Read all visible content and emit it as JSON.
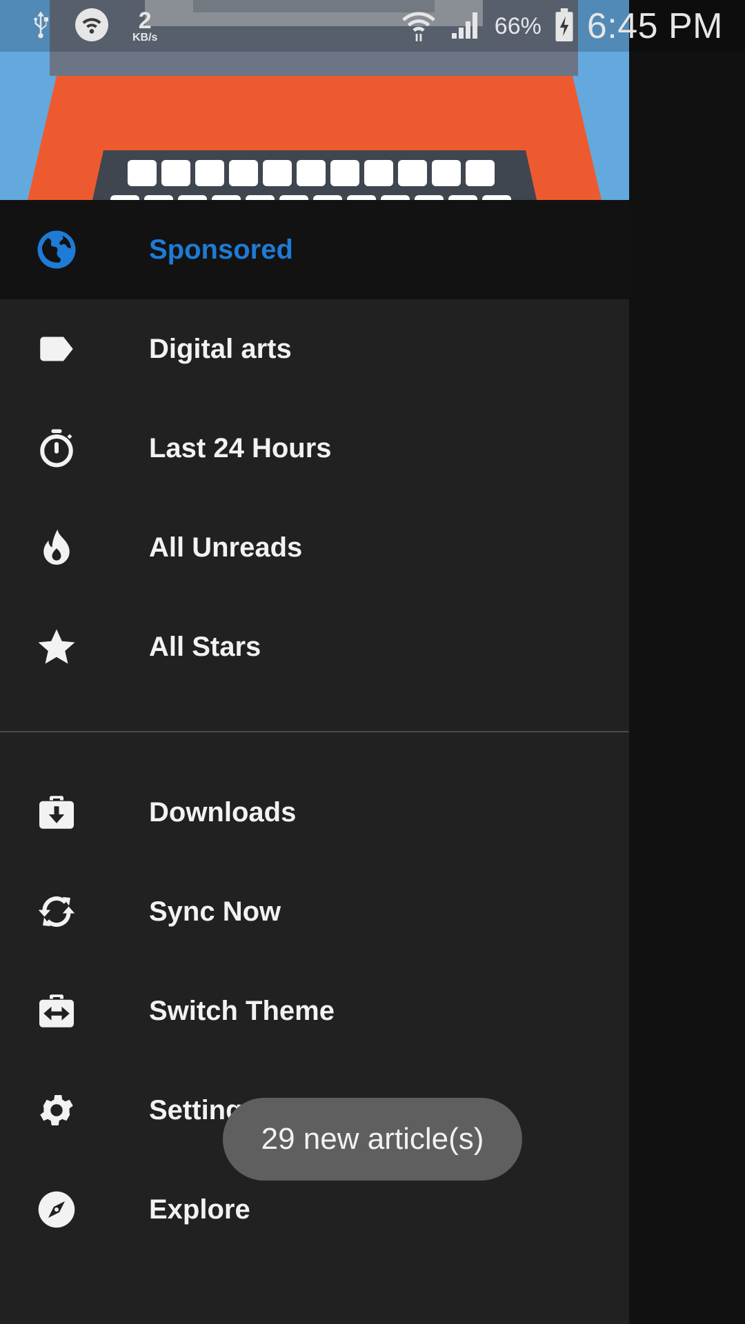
{
  "status_bar": {
    "net_speed_value": "2",
    "net_speed_unit": "KB/s",
    "battery_percent": "66%",
    "time": "6:45 PM",
    "icons": [
      "usb-icon",
      "wifi-hotspot-icon",
      "wifi-icon",
      "signal-icon",
      "battery-charging-icon"
    ]
  },
  "drawer": {
    "primary_items": [
      {
        "label": "Sponsored",
        "icon": "globe-icon",
        "active": true
      },
      {
        "label": "Digital arts",
        "icon": "label-tag-icon"
      },
      {
        "label": "Last 24 Hours",
        "icon": "stopwatch-icon"
      },
      {
        "label": "All Unreads",
        "icon": "flame-icon"
      },
      {
        "label": "All Stars",
        "icon": "star-icon"
      }
    ],
    "secondary_items": [
      {
        "label": "Downloads",
        "icon": "download-case-icon"
      },
      {
        "label": "Sync Now",
        "icon": "sync-icon"
      },
      {
        "label": "Switch Theme",
        "icon": "switch-theme-icon"
      },
      {
        "label": "Settings",
        "icon": "gear-icon"
      },
      {
        "label": "Explore",
        "icon": "compass-icon"
      }
    ],
    "accent_color": "#1e7bd6"
  },
  "toast": {
    "text": "29 new article(s)"
  }
}
